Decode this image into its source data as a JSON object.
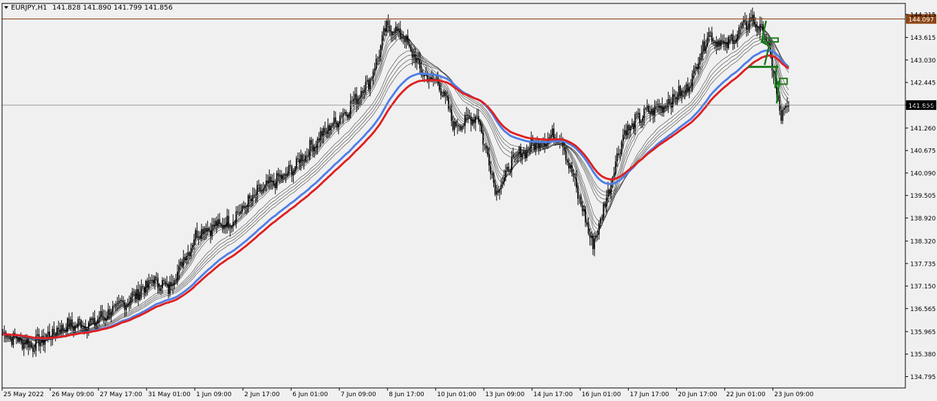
{
  "header": {
    "symbol_timeframe": "EURJPY,H1",
    "ohlc": "141.828 141.890 141.799 141.856"
  },
  "colors": {
    "background": "#f0f0f0",
    "plot_border": "#000000",
    "candles": "#000000",
    "ma_fan": "#3a3a3a",
    "ma_blue": "#4f7fe6",
    "ma_red": "#e02020",
    "resistance_line": "#8b4513",
    "current_price_line": "#8c8c8c",
    "pattern_drawing": "#1a7a1a"
  },
  "chart_data": {
    "type": "candlestick",
    "symbol": "EURJPY",
    "timeframe": "H1",
    "y_axis": {
      "position": "right",
      "ylim": [
        134.5,
        144.5
      ],
      "ticks": [
        144.215,
        143.615,
        143.03,
        142.445,
        141.856,
        141.26,
        140.675,
        140.09,
        139.505,
        138.92,
        138.32,
        137.735,
        137.15,
        136.565,
        135.965,
        135.38,
        134.795
      ],
      "tick_labels": [
        "144.215",
        "143.615",
        "143.030",
        "142.445",
        "141.856",
        "141.260",
        "140.675",
        "140.090",
        "139.505",
        "138.920",
        "138.320",
        "137.735",
        "137.150",
        "136.565",
        "135.965",
        "135.380",
        "134.795"
      ]
    },
    "x_axis": {
      "n_bars": 600,
      "time_labels": [
        "25 May 2022",
        "26 May 09:00",
        "27 May 17:00",
        "31 May 01:00",
        "1 Jun 09:00",
        "2 Jun 17:00",
        "6 Jun 01:00",
        "7 Jun 09:00",
        "8 Jun 17:00",
        "10 Jun 01:00",
        "13 Jun 09:00",
        "14 Jun 17:00",
        "16 Jun 01:00",
        "17 Jun 17:00",
        "20 Jun 17:00",
        "22 Jun 01:00",
        "23 Jun 09:00"
      ],
      "label_bar_index": [
        0,
        32,
        64,
        96,
        128,
        160,
        192,
        224,
        256,
        288,
        320,
        352,
        384,
        416,
        448,
        480,
        512
      ]
    },
    "price_anchors": [
      {
        "bar": 0,
        "price": 135.9
      },
      {
        "bar": 20,
        "price": 135.6
      },
      {
        "bar": 40,
        "price": 136.1
      },
      {
        "bar": 60,
        "price": 136.2
      },
      {
        "bar": 80,
        "price": 136.7
      },
      {
        "bar": 100,
        "price": 137.3
      },
      {
        "bar": 110,
        "price": 137.1
      },
      {
        "bar": 130,
        "price": 138.6
      },
      {
        "bar": 150,
        "price": 138.8
      },
      {
        "bar": 170,
        "price": 139.6
      },
      {
        "bar": 190,
        "price": 140.1
      },
      {
        "bar": 210,
        "price": 141.0
      },
      {
        "bar": 230,
        "price": 141.8
      },
      {
        "bar": 245,
        "price": 142.6
      },
      {
        "bar": 255,
        "price": 143.9
      },
      {
        "bar": 265,
        "price": 143.7
      },
      {
        "bar": 280,
        "price": 142.6
      },
      {
        "bar": 290,
        "price": 142.4
      },
      {
        "bar": 300,
        "price": 141.3
      },
      {
        "bar": 315,
        "price": 141.6
      },
      {
        "bar": 328,
        "price": 139.6
      },
      {
        "bar": 340,
        "price": 140.5
      },
      {
        "bar": 355,
        "price": 140.9
      },
      {
        "bar": 370,
        "price": 141.1
      },
      {
        "bar": 380,
        "price": 139.8
      },
      {
        "bar": 392,
        "price": 138.2
      },
      {
        "bar": 400,
        "price": 139.3
      },
      {
        "bar": 412,
        "price": 141.1
      },
      {
        "bar": 425,
        "price": 141.6
      },
      {
        "bar": 440,
        "price": 141.9
      },
      {
        "bar": 455,
        "price": 142.3
      },
      {
        "bar": 468,
        "price": 143.7
      },
      {
        "bar": 480,
        "price": 143.4
      },
      {
        "bar": 497,
        "price": 144.1
      },
      {
        "bar": 507,
        "price": 143.6
      },
      {
        "bar": 513,
        "price": 142.4
      },
      {
        "bar": 517,
        "price": 141.5
      },
      {
        "bar": 522,
        "price": 141.856
      }
    ],
    "indicators": {
      "ma_fan_count": 10,
      "ma_fan_periods": [
        3,
        5,
        8,
        10,
        12,
        15,
        30,
        35,
        40,
        45,
        50,
        60
      ],
      "ma_blue_period": 60,
      "ma_red_period": 70
    },
    "levels": [
      {
        "name": "resistance",
        "price": 144.097,
        "label": "144.097"
      },
      {
        "name": "current",
        "price": 141.856,
        "label": "141.856"
      }
    ]
  }
}
